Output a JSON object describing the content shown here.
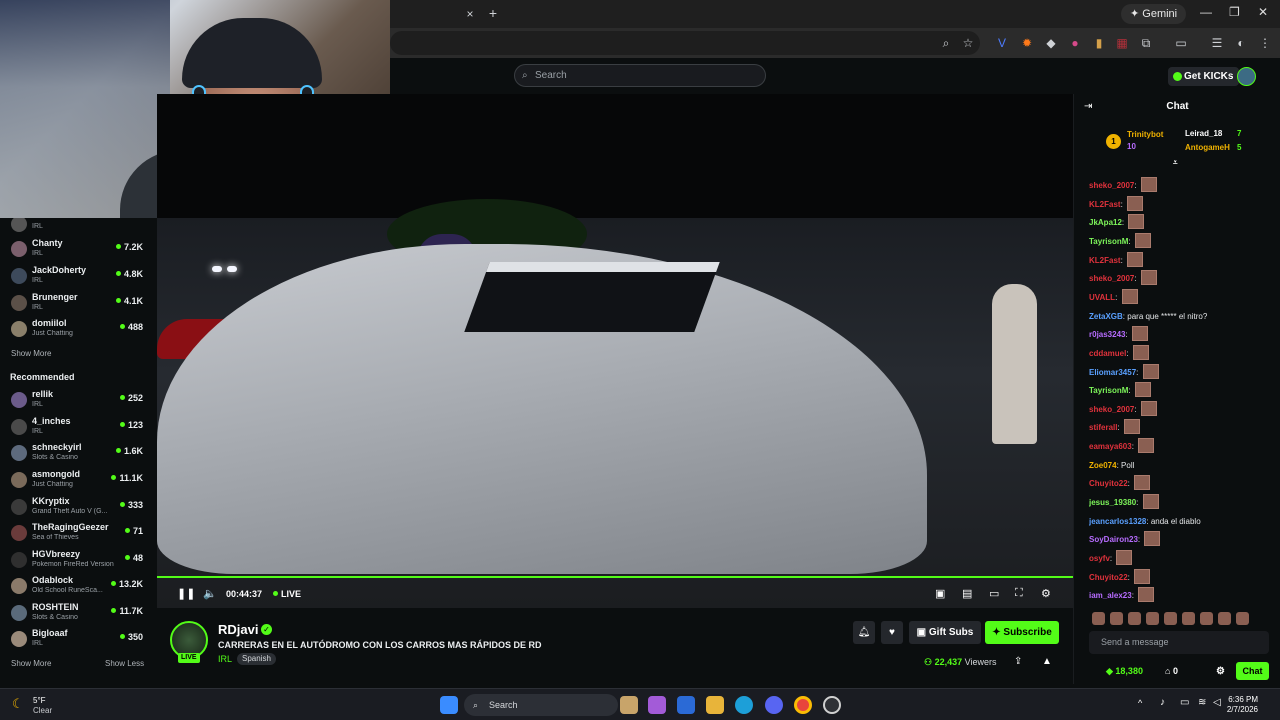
{
  "browser": {
    "gemini_label": "Gemini",
    "new_tab": "+",
    "close_tab": "×"
  },
  "header": {
    "search_placeholder": "Search",
    "get_kicks": "Get KICKs"
  },
  "sidebar": {
    "following": [
      {
        "name": "Chanty",
        "category": "IRL",
        "viewers": "7.2K"
      },
      {
        "name": "JackDoherty",
        "category": "IRL",
        "viewers": "4.8K"
      },
      {
        "name": "Brunenger",
        "category": "IRL",
        "viewers": "4.1K"
      },
      {
        "name": "domiilol",
        "category": "Just Chatting",
        "viewers": "488"
      }
    ],
    "show_more_1": "Show More",
    "recommended_title": "Recommended",
    "recommended": [
      {
        "name": "rellik",
        "category": "IRL",
        "viewers": "252"
      },
      {
        "name": "4_inches",
        "category": "IRL",
        "viewers": "123"
      },
      {
        "name": "schneckyirl",
        "category": "Slots & Casino",
        "viewers": "1.6K"
      },
      {
        "name": "asmongold",
        "category": "Just Chatting",
        "viewers": "11.1K"
      },
      {
        "name": "KKryptix",
        "category": "Grand Theft Auto V (G...",
        "viewers": "333"
      },
      {
        "name": "TheRagingGeezer",
        "category": "Sea of Thieves",
        "viewers": "71"
      },
      {
        "name": "HGVbreezy",
        "category": "Pokemon FireRed Version",
        "viewers": "48"
      },
      {
        "name": "Odablock",
        "category": "Old School RuneSca...",
        "viewers": "13.2K"
      },
      {
        "name": "ROSHTEIN",
        "category": "Slots & Casino",
        "viewers": "11.7K"
      },
      {
        "name": "Bigloaaf",
        "category": "IRL",
        "viewers": "350"
      }
    ],
    "show_more_2": "Show More",
    "show_less": "Show Less",
    "partial_top": {
      "category": "IRL"
    }
  },
  "player": {
    "time": "00:44:37",
    "live": "LIVE",
    "progress_percent": 100
  },
  "stream": {
    "channel": "RDjavi",
    "live_badge": "LIVE",
    "title": "CARRERAS EN EL AUTÓDROMO CON LOS CARROS MAS RÁPIDOS DE RD",
    "category": "IRL",
    "tag": "Spanish",
    "gift_subs": "Gift Subs",
    "subscribe": "Subscribe",
    "viewers_count": "22,437",
    "viewers_label": "Viewers"
  },
  "chat": {
    "title": "Chat",
    "leaderboard": {
      "rank": "1",
      "first_name": "Trinitybot",
      "first_count": "10",
      "second_name": "Leirad_18",
      "second_count": "7",
      "third_name": "AntogameH",
      "third_count": "5"
    },
    "messages": [
      {
        "user": "sheko_2007",
        "color": "#e0323c",
        "text": "",
        "emotes": 1
      },
      {
        "user": "KL2Fast",
        "color": "#e0323c",
        "text": "",
        "emotes": 1
      },
      {
        "user": "JkApa12",
        "color": "#7df55a",
        "text": "",
        "emotes": 1
      },
      {
        "user": "TayrisonM",
        "color": "#7df55a",
        "text": "",
        "emotes": 1
      },
      {
        "user": "KL2Fast",
        "color": "#e0323c",
        "text": "",
        "emotes": 1
      },
      {
        "user": "sheko_2007",
        "color": "#e0323c",
        "text": "",
        "emotes": 1
      },
      {
        "user": "UVALL",
        "color": "#e0323c",
        "text": "",
        "emotes": 1
      },
      {
        "user": "ZetaXGB",
        "color": "#5aa0ff",
        "text": "para que ***** el nitro?",
        "emotes": 0
      },
      {
        "user": "r0jas3243",
        "color": "#b76cff",
        "text": "",
        "emotes": 1
      },
      {
        "user": "cddamuel",
        "color": "#e0323c",
        "text": "",
        "emotes": 1
      },
      {
        "user": "Eliomar3457",
        "color": "#5aa0ff",
        "text": "",
        "emotes": 1
      },
      {
        "user": "TayrisonM",
        "color": "#7df55a",
        "text": "",
        "emotes": 1
      },
      {
        "user": "sheko_2007",
        "color": "#e0323c",
        "text": "",
        "emotes": 1
      },
      {
        "user": "stiferall",
        "color": "#e0323c",
        "text": "",
        "emotes": 1
      },
      {
        "user": "eamaya603",
        "color": "#e0323c",
        "text": "",
        "emotes": 1
      },
      {
        "user": "Zoe074",
        "color": "#f0b200",
        "text": "Poll",
        "emotes": 0
      },
      {
        "user": "Chuyito22",
        "color": "#e0323c",
        "text": "",
        "emotes": 1
      },
      {
        "user": "jesus_19380",
        "color": "#7df55a",
        "text": "",
        "emotes": 1
      },
      {
        "user": "jeancarlos1328",
        "color": "#5aa0ff",
        "text": "anda el diablo",
        "emotes": 0
      },
      {
        "user": "SoyDairon23",
        "color": "#b76cff",
        "text": "",
        "emotes": 1
      },
      {
        "user": "osyfv",
        "color": "#e0323c",
        "text": "",
        "emotes": 1
      },
      {
        "user": "Chuyito22",
        "color": "#e0323c",
        "text": "",
        "emotes": 1
      },
      {
        "user": "iam_alex23",
        "color": "#b76cff",
        "text": "",
        "emotes": 1
      }
    ],
    "input_placeholder": "Send a message",
    "points": "18,380",
    "points2": "0",
    "send_button": "Chat"
  },
  "taskbar": {
    "temp": "5°F",
    "condition": "Clear",
    "search": "Search",
    "time": "6:36 PM",
    "date": "2/7/2026"
  },
  "colors": {
    "accent": "#53fc18",
    "background": "#0b0e0f"
  }
}
